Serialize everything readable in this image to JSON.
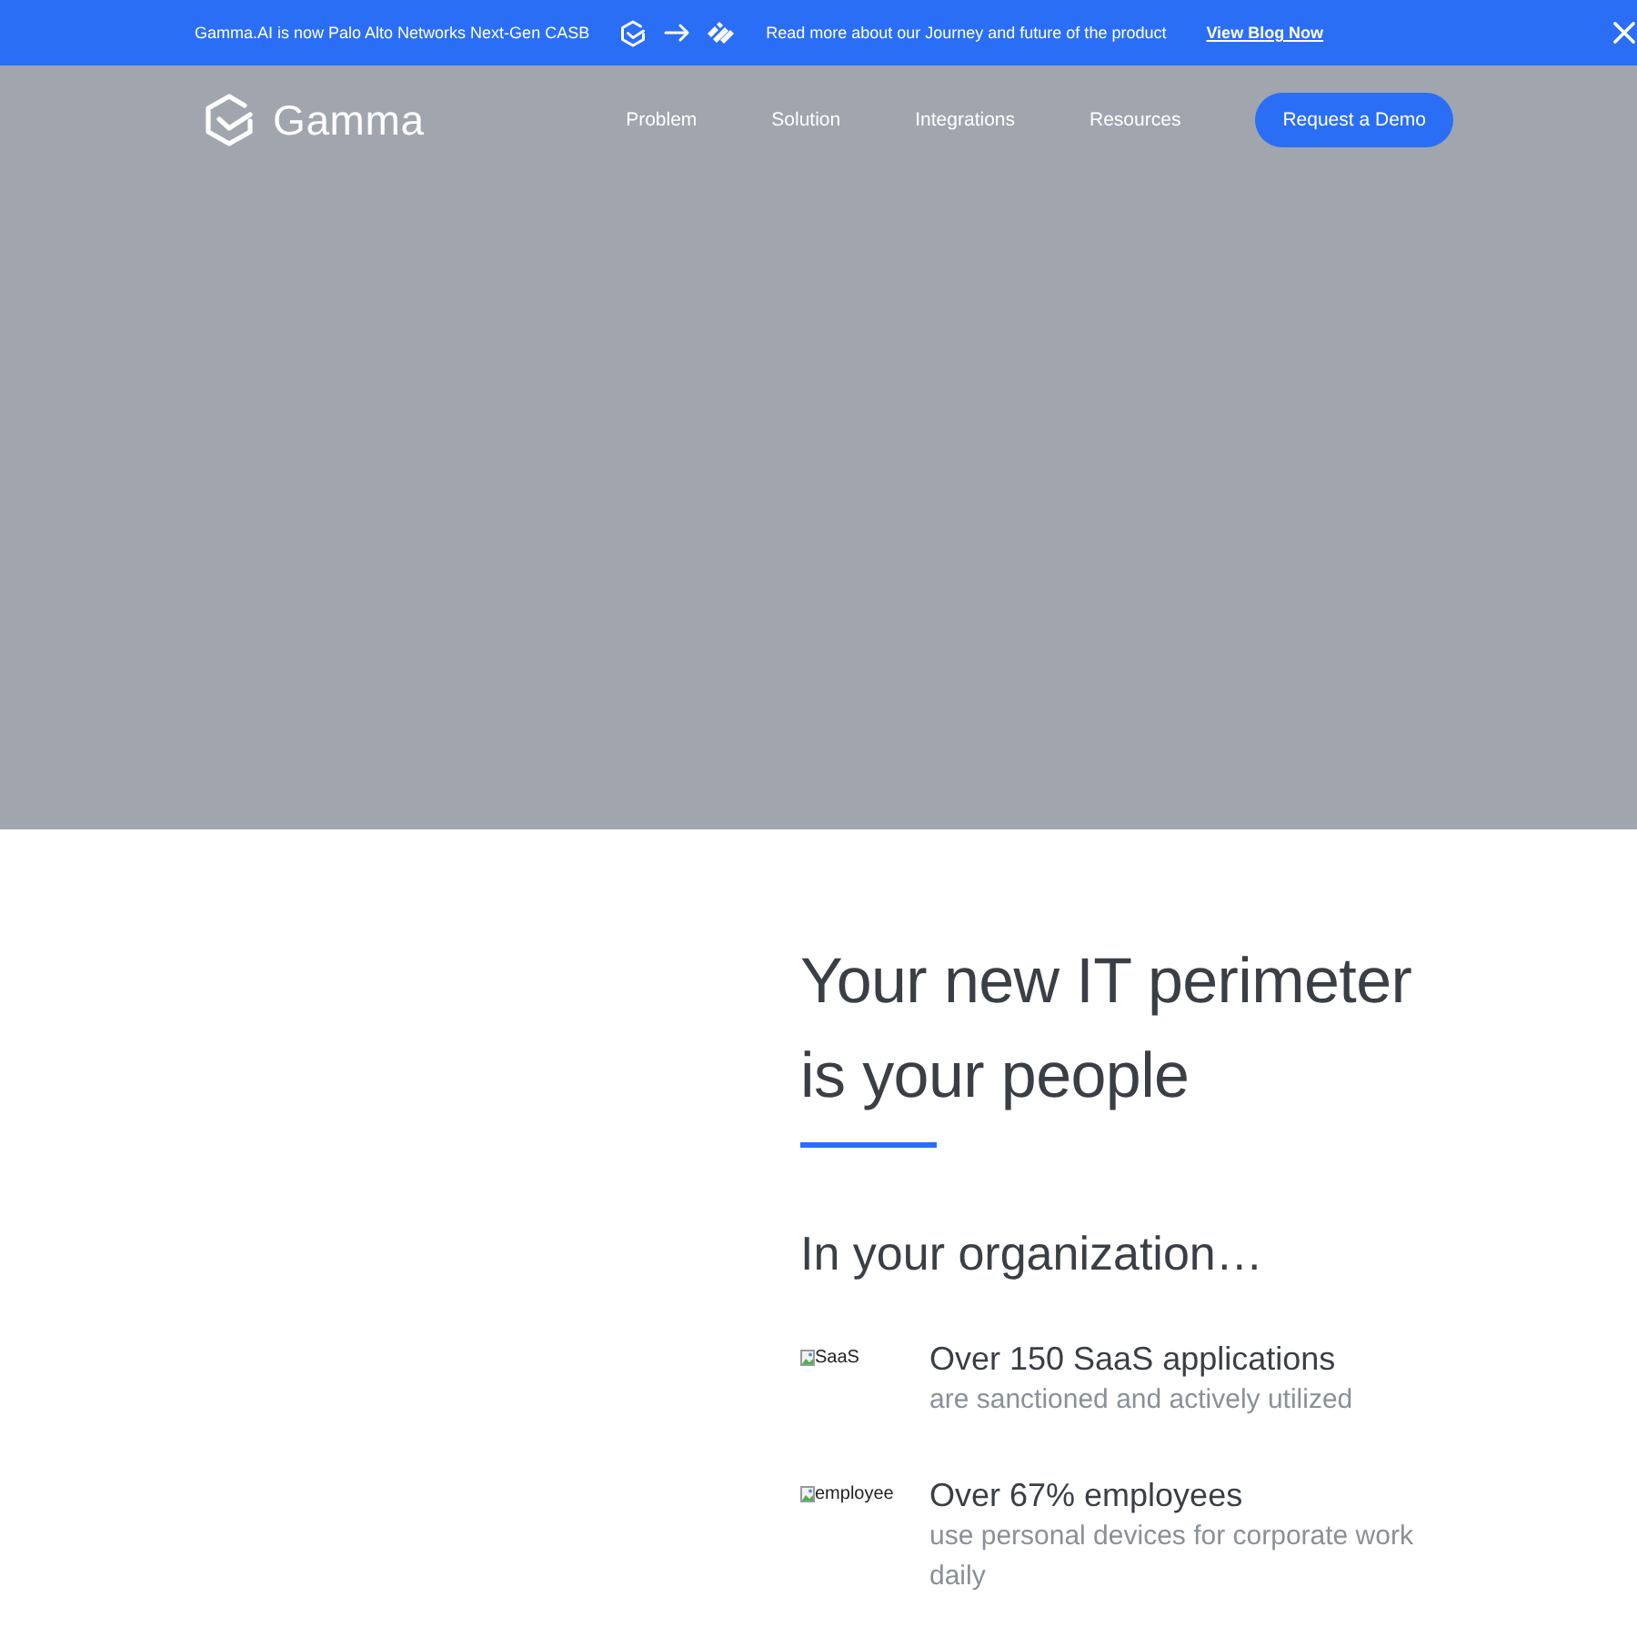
{
  "banner": {
    "announcement": "Gamma.AI is now Palo Alto Networks Next-Gen CASB",
    "message": "Read more about our Journey and future of the product",
    "link": "View Blog Now"
  },
  "header": {
    "logo": "Gamma",
    "nav": [
      {
        "label": "Problem"
      },
      {
        "label": "Solution"
      },
      {
        "label": "Integrations"
      },
      {
        "label": "Resources"
      }
    ],
    "cta": "Request a Demo"
  },
  "section": {
    "heading": "Your new IT perimeter is your people",
    "subheading": "In your organization…",
    "stats": [
      {
        "image_alt": "SaaS",
        "title": "Over 150 SaaS applications",
        "description": "are sanctioned and actively utilized"
      },
      {
        "image_alt": "employee",
        "title": "Over 67% employees",
        "description": "use personal devices for corporate work daily"
      }
    ]
  }
}
